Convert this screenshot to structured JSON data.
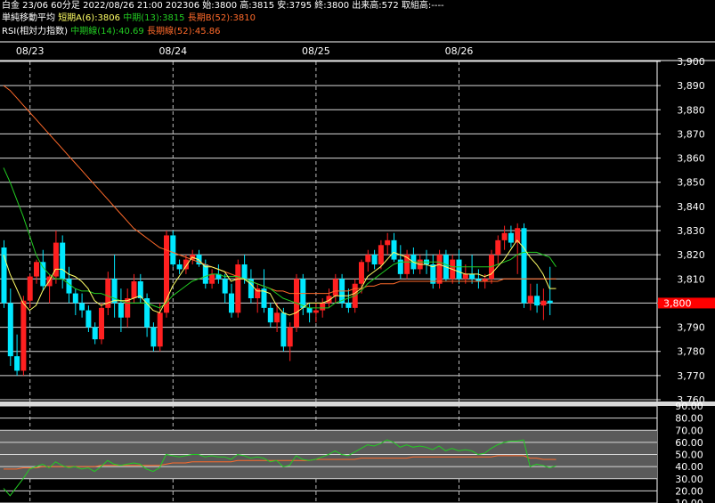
{
  "header": {
    "line1": "白金 23/06 60分足 2022/08/26 21:00 202306 始:3800 高:3815 安:3795 終:3800 出来高:572 取組高:----",
    "ma_title": "単純移動平均",
    "ma_short": "短期A(6):3806",
    "ma_mid": "中期(13):3815",
    "ma_long": "長期B(52):3810",
    "rsi_title": "RSI(相対力指数)",
    "rsi_mid": "中期線(14):40.69",
    "rsi_long": "長期線(52):45.86"
  },
  "colors": {
    "up": "#ff2020",
    "down": "#00e8ff",
    "ma_short": "#ffff66",
    "ma_mid": "#22cc22",
    "ma_long": "#ff6a2a",
    "rsi_mid": "#22cc22",
    "rsi_long": "#ff6a2a",
    "price_tag_bg": "#ff0000"
  },
  "chart_data": [
    {
      "type": "candlestick",
      "ylim": [
        3760,
        3900
      ],
      "yticks": [
        "3,900",
        "3,890",
        "3,880",
        "3,870",
        "3,860",
        "3,850",
        "3,840",
        "3,830",
        "3,820",
        "3,810",
        "3,800",
        "3,790",
        "3,780",
        "3,770",
        "3,760"
      ],
      "date_labels": [
        {
          "label": "08/23",
          "index": 4
        },
        {
          "label": "08/24",
          "index": 26
        },
        {
          "label": "08/25",
          "index": 48
        },
        {
          "label": "08/26",
          "index": 70
        }
      ],
      "last_price_label": "3,800",
      "ohlc": [
        [
          3823,
          3826,
          3798,
          3800
        ],
        [
          3800,
          3806,
          3774,
          3778
        ],
        [
          3778,
          3787,
          3770,
          3772
        ],
        [
          3772,
          3803,
          3770,
          3801
        ],
        [
          3801,
          3812,
          3798,
          3811
        ],
        [
          3811,
          3818,
          3808,
          3817
        ],
        [
          3817,
          3822,
          3805,
          3807
        ],
        [
          3807,
          3812,
          3800,
          3811
        ],
        [
          3811,
          3830,
          3808,
          3825
        ],
        [
          3825,
          3828,
          3806,
          3810
        ],
        [
          3810,
          3815,
          3800,
          3804
        ],
        [
          3804,
          3806,
          3795,
          3800
        ],
        [
          3800,
          3804,
          3794,
          3797
        ],
        [
          3797,
          3799,
          3788,
          3790
        ],
        [
          3790,
          3792,
          3783,
          3785
        ],
        [
          3785,
          3800,
          3783,
          3798
        ],
        [
          3798,
          3813,
          3795,
          3810
        ],
        [
          3810,
          3820,
          3794,
          3800
        ],
        [
          3800,
          3806,
          3788,
          3794
        ],
        [
          3794,
          3806,
          3790,
          3802
        ],
        [
          3802,
          3812,
          3800,
          3809
        ],
        [
          3809,
          3812,
          3800,
          3802
        ],
        [
          3802,
          3804,
          3786,
          3790
        ],
        [
          3790,
          3792,
          3780,
          3782
        ],
        [
          3782,
          3800,
          3780,
          3796
        ],
        [
          3796,
          3830,
          3794,
          3828
        ],
        [
          3828,
          3830,
          3815,
          3816
        ],
        [
          3816,
          3818,
          3812,
          3814
        ],
        [
          3814,
          3820,
          3812,
          3818
        ],
        [
          3818,
          3822,
          3816,
          3820
        ],
        [
          3820,
          3822,
          3815,
          3816
        ],
        [
          3816,
          3818,
          3806,
          3808
        ],
        [
          3808,
          3814,
          3806,
          3812
        ],
        [
          3812,
          3816,
          3808,
          3810
        ],
        [
          3810,
          3812,
          3800,
          3804
        ],
        [
          3804,
          3808,
          3794,
          3796
        ],
        [
          3796,
          3818,
          3794,
          3816
        ],
        [
          3816,
          3820,
          3808,
          3810
        ],
        [
          3810,
          3814,
          3800,
          3802
        ],
        [
          3802,
          3808,
          3796,
          3806
        ],
        [
          3806,
          3814,
          3796,
          3798
        ],
        [
          3798,
          3800,
          3790,
          3792
        ],
        [
          3792,
          3800,
          3788,
          3796
        ],
        [
          3796,
          3798,
          3780,
          3782
        ],
        [
          3782,
          3792,
          3776,
          3790
        ],
        [
          3790,
          3812,
          3788,
          3810
        ],
        [
          3810,
          3812,
          3795,
          3798
        ],
        [
          3798,
          3800,
          3792,
          3796
        ],
        [
          3796,
          3800,
          3792,
          3797
        ],
        [
          3797,
          3802,
          3794,
          3800
        ],
        [
          3800,
          3806,
          3798,
          3803
        ],
        [
          3803,
          3812,
          3800,
          3810
        ],
        [
          3810,
          3812,
          3798,
          3800
        ],
        [
          3800,
          3806,
          3796,
          3798
        ],
        [
          3798,
          3810,
          3796,
          3808
        ],
        [
          3808,
          3818,
          3804,
          3817
        ],
        [
          3817,
          3822,
          3813,
          3820
        ],
        [
          3820,
          3822,
          3814,
          3816
        ],
        [
          3816,
          3826,
          3814,
          3824
        ],
        [
          3824,
          3829,
          3820,
          3826
        ],
        [
          3826,
          3829,
          3817,
          3818
        ],
        [
          3818,
          3824,
          3810,
          3812
        ],
        [
          3812,
          3822,
          3810,
          3820
        ],
        [
          3820,
          3823,
          3812,
          3814
        ],
        [
          3814,
          3820,
          3812,
          3818
        ],
        [
          3818,
          3822,
          3812,
          3816
        ],
        [
          3816,
          3820,
          3806,
          3808
        ],
        [
          3808,
          3822,
          3806,
          3820
        ],
        [
          3820,
          3822,
          3809,
          3810
        ],
        [
          3810,
          3820,
          3808,
          3818
        ],
        [
          3818,
          3822,
          3808,
          3810
        ],
        [
          3810,
          3816,
          3808,
          3812
        ],
        [
          3812,
          3820,
          3808,
          3810
        ],
        [
          3810,
          3814,
          3806,
          3809
        ],
        [
          3809,
          3812,
          3806,
          3810
        ],
        [
          3810,
          3822,
          3808,
          3820
        ],
        [
          3820,
          3828,
          3816,
          3826
        ],
        [
          3826,
          3832,
          3822,
          3829
        ],
        [
          3829,
          3832,
          3823,
          3825
        ],
        [
          3825,
          3833,
          3812,
          3831
        ],
        [
          3831,
          3833,
          3798,
          3800
        ],
        [
          3800,
          3808,
          3797,
          3803
        ],
        [
          3803,
          3808,
          3796,
          3799
        ],
        [
          3799,
          3806,
          3793,
          3801
        ],
        [
          3801,
          3815,
          3795,
          3800
        ]
      ],
      "ma_short": [
        3820,
        3812,
        3806,
        3800,
        3797,
        3799,
        3805,
        3809,
        3814,
        3814,
        3812,
        3811,
        3809,
        3806,
        3801,
        3799,
        3800,
        3801,
        3801,
        3801,
        3802,
        3803,
        3800,
        3797,
        3796,
        3801,
        3807,
        3811,
        3815,
        3819,
        3818,
        3815,
        3815,
        3814,
        3813,
        3809,
        3810,
        3810,
        3808,
        3805,
        3805,
        3804,
        3799,
        3796,
        3795,
        3796,
        3798,
        3800,
        3800,
        3800,
        3801,
        3803,
        3803,
        3803,
        3804,
        3806,
        3811,
        3813,
        3815,
        3818,
        3821,
        3820,
        3819,
        3817,
        3816,
        3816,
        3815,
        3816,
        3815,
        3814,
        3813,
        3812,
        3812,
        3812,
        3811,
        3812,
        3815,
        3818,
        3822,
        3826,
        3823,
        3819,
        3816,
        3812,
        3806,
        3806
      ],
      "ma_mid": [
        3856,
        3850,
        3843,
        3836,
        3828,
        3820,
        3815,
        3812,
        3810,
        3810,
        3808,
        3806,
        3805,
        3805,
        3804,
        3804,
        3803,
        3802,
        3801,
        3800,
        3800,
        3800,
        3800,
        3799,
        3798,
        3800,
        3803,
        3805,
        3807,
        3809,
        3810,
        3811,
        3812,
        3812,
        3811,
        3811,
        3811,
        3810,
        3809,
        3808,
        3807,
        3806,
        3804,
        3802,
        3801,
        3800,
        3799,
        3798,
        3798,
        3798,
        3798,
        3800,
        3801,
        3802,
        3803,
        3805,
        3808,
        3810,
        3812,
        3814,
        3816,
        3817,
        3817,
        3817,
        3817,
        3817,
        3817,
        3817,
        3816,
        3815,
        3815,
        3815,
        3815,
        3815,
        3815,
        3815,
        3816,
        3817,
        3818,
        3820,
        3821,
        3821,
        3821,
        3820,
        3819,
        3815
      ],
      "ma_long": [
        3890,
        3888,
        3885,
        3882,
        3879,
        3876,
        3873,
        3870,
        3867,
        3864,
        3861,
        3858,
        3855,
        3852,
        3849,
        3846,
        3843,
        3840,
        3837,
        3834,
        3831,
        3829,
        3827,
        3825,
        3823,
        3822,
        3821,
        3820,
        3819,
        3818,
        3817,
        3816,
        3815,
        3814,
        3813,
        3812,
        3811,
        3810,
        3809,
        3808,
        3807,
        3806,
        3805,
        3805,
        3804,
        3804,
        3804,
        3804,
        3804,
        3804,
        3804,
        3805,
        3805,
        3805,
        3806,
        3806,
        3807,
        3807,
        3808,
        3808,
        3808,
        3809,
        3809,
        3809,
        3809,
        3809,
        3809,
        3809,
        3809,
        3809,
        3809,
        3809,
        3809,
        3809,
        3809,
        3809,
        3809,
        3810,
        3810,
        3810,
        3810,
        3810,
        3810,
        3810,
        3810,
        3810
      ]
    },
    {
      "type": "line",
      "ylim": [
        10,
        90
      ],
      "yticks": [
        "90.00",
        "80.00",
        "70.00",
        "60.00",
        "50.00",
        "40.00",
        "30.00",
        "20.00",
        "10.00"
      ],
      "bands": [
        [
          30,
          70
        ]
      ],
      "series": [
        {
          "name": "中期線(14)",
          "values": [
            22,
            16,
            23,
            30,
            38,
            40,
            42,
            39,
            44,
            41,
            39,
            40,
            38,
            39,
            36,
            40,
            45,
            42,
            41,
            42,
            43,
            42,
            38,
            36,
            39,
            50,
            49,
            48,
            49,
            50,
            50,
            48,
            49,
            48,
            48,
            46,
            50,
            49,
            47,
            48,
            47,
            44,
            45,
            40,
            41,
            49,
            46,
            45,
            46,
            48,
            50,
            53,
            50,
            49,
            52,
            55,
            58,
            57,
            59,
            62,
            60,
            56,
            58,
            56,
            57,
            56,
            54,
            57,
            53,
            55,
            53,
            54,
            53,
            50,
            51,
            55,
            58,
            60,
            61,
            61,
            62,
            40,
            42,
            41,
            39,
            40.69
          ]
        },
        {
          "name": "長期線(52)",
          "values": [
            38,
            38,
            38,
            39,
            39,
            39,
            40,
            40,
            40,
            40,
            40,
            40,
            40,
            40,
            40,
            41,
            41,
            41,
            41,
            41,
            41,
            41,
            41,
            41,
            41,
            42,
            43,
            43,
            43,
            44,
            44,
            44,
            44,
            44,
            44,
            44,
            45,
            45,
            45,
            45,
            45,
            45,
            45,
            45,
            45,
            45,
            45,
            45,
            46,
            46,
            46,
            46,
            46,
            46,
            46,
            47,
            47,
            47,
            47,
            47,
            47,
            47,
            47,
            48,
            48,
            48,
            48,
            48,
            48,
            48,
            48,
            48,
            48,
            48,
            48,
            48,
            49,
            49,
            49,
            49,
            49,
            47,
            47,
            46,
            46,
            45.86
          ]
        }
      ]
    }
  ]
}
